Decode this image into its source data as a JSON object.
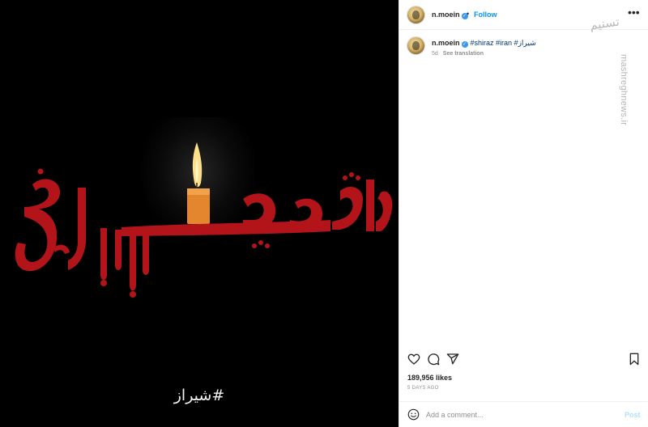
{
  "media": {
    "title_text": "شاهچراغ",
    "hashtag_overlay": "#شیراز",
    "colors": {
      "background": "#000000",
      "calligraphy": "#b3141a",
      "flame": "#ffd36b",
      "candle": "#e58a2b"
    }
  },
  "post": {
    "username": "n.moein",
    "verified": true,
    "follow_label": "Follow",
    "separator": "•",
    "more_icon": "more-horizontal-icon"
  },
  "watermark": {
    "logo_text": "تسنیم",
    "url_text": "mashreghnews.ir"
  },
  "caption": {
    "username": "n.moein",
    "tags": "#shiraz #iran #شیراز",
    "age": "5d",
    "see_translation": "See translation"
  },
  "actions": {
    "icons": [
      "heart-icon",
      "comment-icon",
      "share-icon",
      "bookmark-icon"
    ],
    "likes": "189,956 likes",
    "date": "5 DAYS AGO"
  },
  "comment": {
    "placeholder": "Add a comment...",
    "post_label": "Post",
    "emoji_icon": "emoji-icon"
  },
  "colors": {
    "accent": "#0095f6",
    "link": "#00376b",
    "muted": "#8e8e8e",
    "post_disabled": "#b2dffc",
    "verified": "#3897f0"
  }
}
